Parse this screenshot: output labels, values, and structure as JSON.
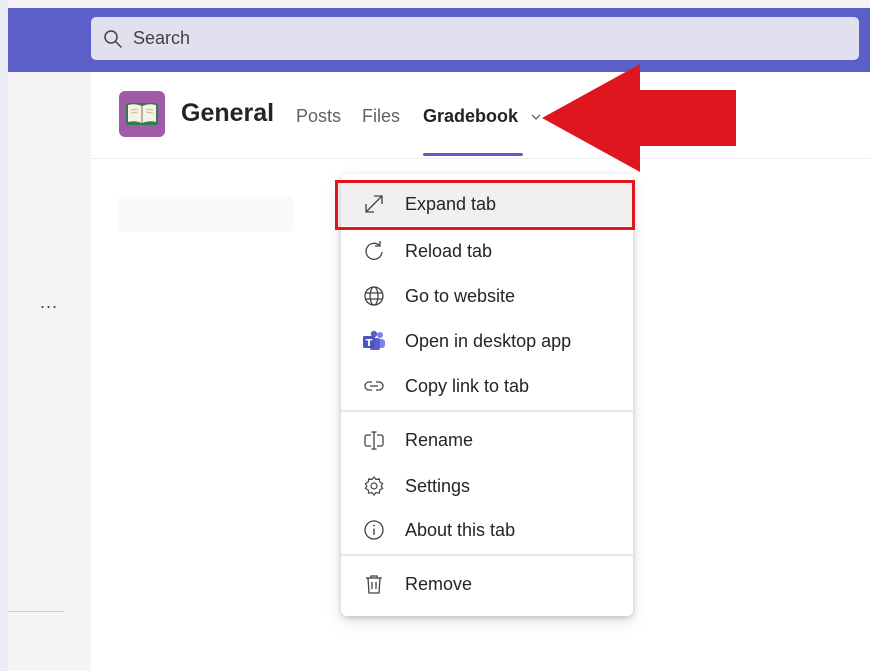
{
  "search": {
    "placeholder": "Search"
  },
  "left_rail": {
    "more_label": "..."
  },
  "channel": {
    "title": "General",
    "tabs": [
      {
        "label": "Posts"
      },
      {
        "label": "Files"
      },
      {
        "label": "Gradebook",
        "active": true
      }
    ]
  },
  "tab_menu": {
    "items": [
      {
        "label": "Expand tab",
        "icon": "expand-icon",
        "highlighted": true
      },
      {
        "label": "Reload tab",
        "icon": "reload-icon"
      },
      {
        "label": "Go to website",
        "icon": "globe-icon"
      },
      {
        "label": "Open in desktop app",
        "icon": "teams-icon"
      },
      {
        "label": "Copy link to tab",
        "icon": "link-icon"
      },
      {
        "label": "Rename",
        "icon": "rename-icon"
      },
      {
        "label": "Settings",
        "icon": "gear-icon"
      },
      {
        "label": "About this tab",
        "icon": "info-icon"
      },
      {
        "label": "Remove",
        "icon": "trash-icon"
      }
    ]
  },
  "colors": {
    "brand": "#5b5fc7",
    "annotation_red": "#e0161f",
    "channel_icon_bg": "#a05aa8"
  }
}
